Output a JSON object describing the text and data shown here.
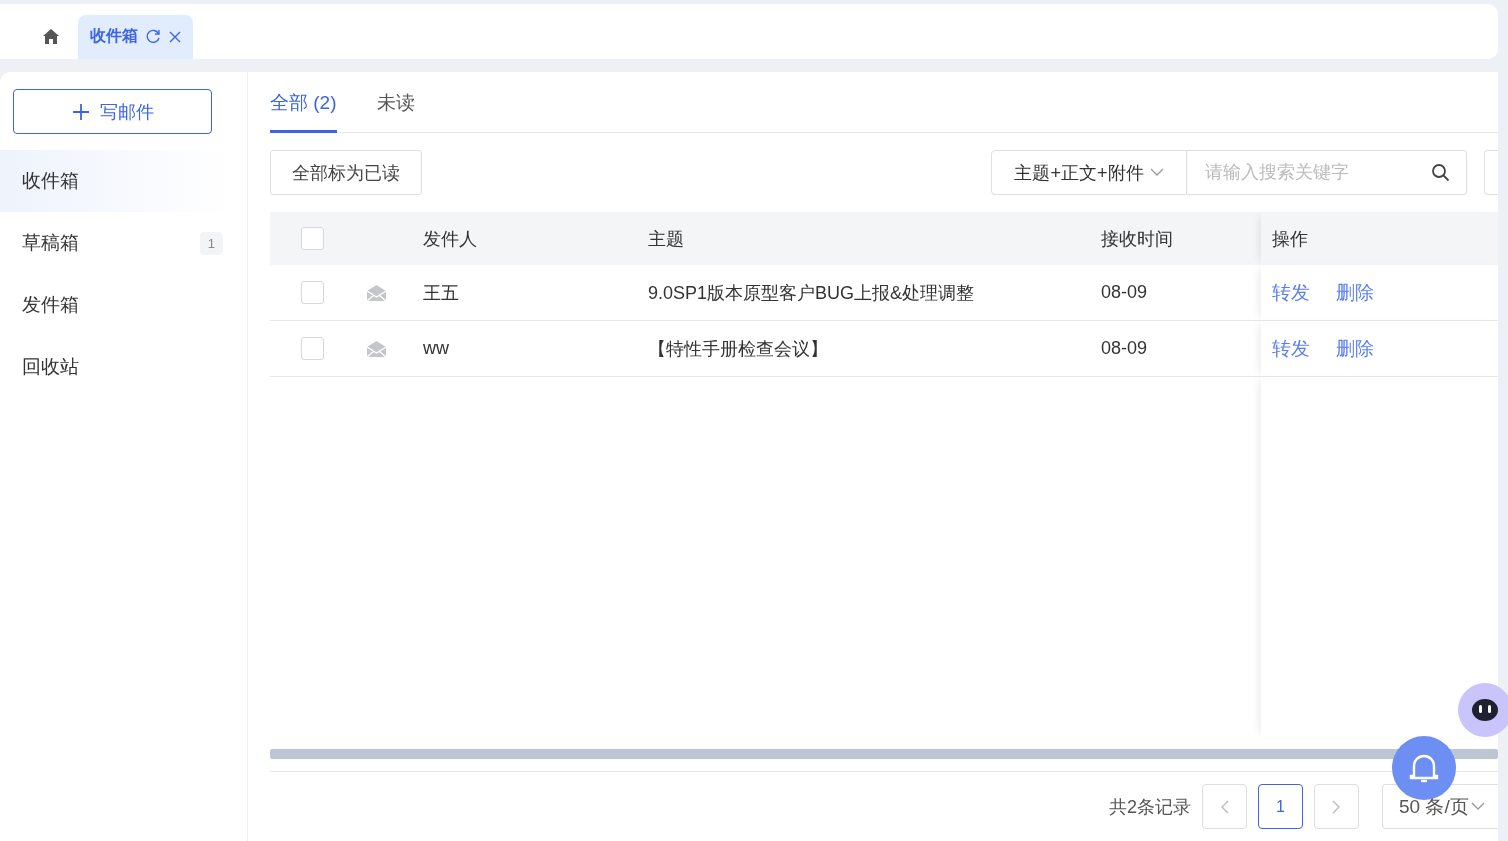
{
  "page_tabs": [
    {
      "kind": "home",
      "selected": false
    },
    {
      "kind": "page",
      "label": "收件箱",
      "selected": true
    }
  ],
  "compose_button": "写邮件",
  "sidebar": {
    "items": [
      {
        "label": "收件箱",
        "selected": true
      },
      {
        "label": "草稿箱",
        "selected": false,
        "badge": "1"
      },
      {
        "label": "发件箱",
        "selected": false
      },
      {
        "label": "回收站",
        "selected": false
      }
    ]
  },
  "filter_tabs": [
    {
      "label": "全部 (2)",
      "selected": true
    },
    {
      "label": "未读",
      "selected": false
    }
  ],
  "mark_all_read_button": "全部标为已读",
  "search": {
    "scope": "主题+正文+附件",
    "placeholder": "请输入搜索关键字"
  },
  "table": {
    "select_all_checked": false,
    "columns": [
      "发件人",
      "主题",
      "接收时间",
      "操作"
    ],
    "rows": [
      {
        "checked": false,
        "read": true,
        "sender": "王五",
        "subject": "9.0SP1版本原型客户BUG上报&处理调整",
        "time": "08-09",
        "actions": [
          "转发",
          "删除"
        ]
      },
      {
        "checked": false,
        "read": true,
        "sender": "ww",
        "subject": "【特性手册检查会议】",
        "time": "08-09",
        "actions": [
          "转发",
          "删除"
        ]
      }
    ]
  },
  "pagination": {
    "total": "共2条记录",
    "pages": [
      {
        "label": "1",
        "selected": true
      }
    ],
    "page_size": "50 条/页"
  }
}
